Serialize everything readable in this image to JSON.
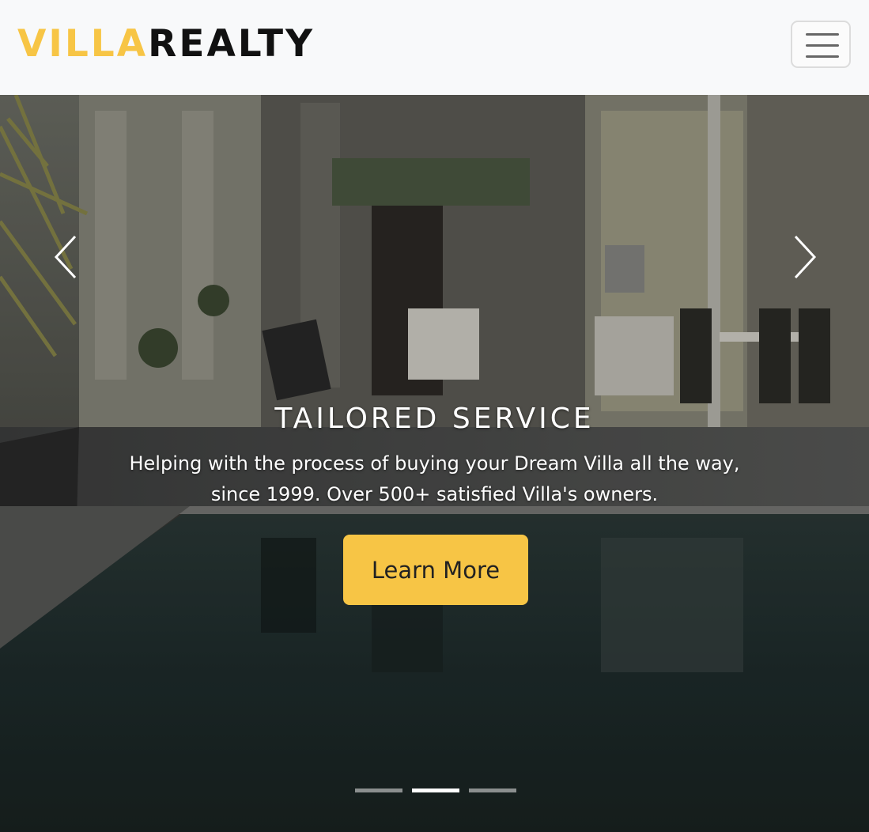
{
  "brand": {
    "accent": "VILLA",
    "main": "REALTY",
    "accent_color": "#f7c545"
  },
  "navbar": {
    "toggler_icon": "hamburger-menu-icon"
  },
  "carousel": {
    "prev_icon": "chevron-left-icon",
    "next_icon": "chevron-right-icon",
    "active_slide": 2,
    "slide_count": 3,
    "slide": {
      "title": "TAILORED SERVICE",
      "text_line1": "Helping with the process of buying your Dream Villa all the way,",
      "text_line2": "since 1999. Over 500+ satisfied Villa's owners.",
      "button_label": "Learn More"
    }
  },
  "colors": {
    "button_bg": "#f7c545",
    "navbar_bg": "#f8f9fa"
  }
}
